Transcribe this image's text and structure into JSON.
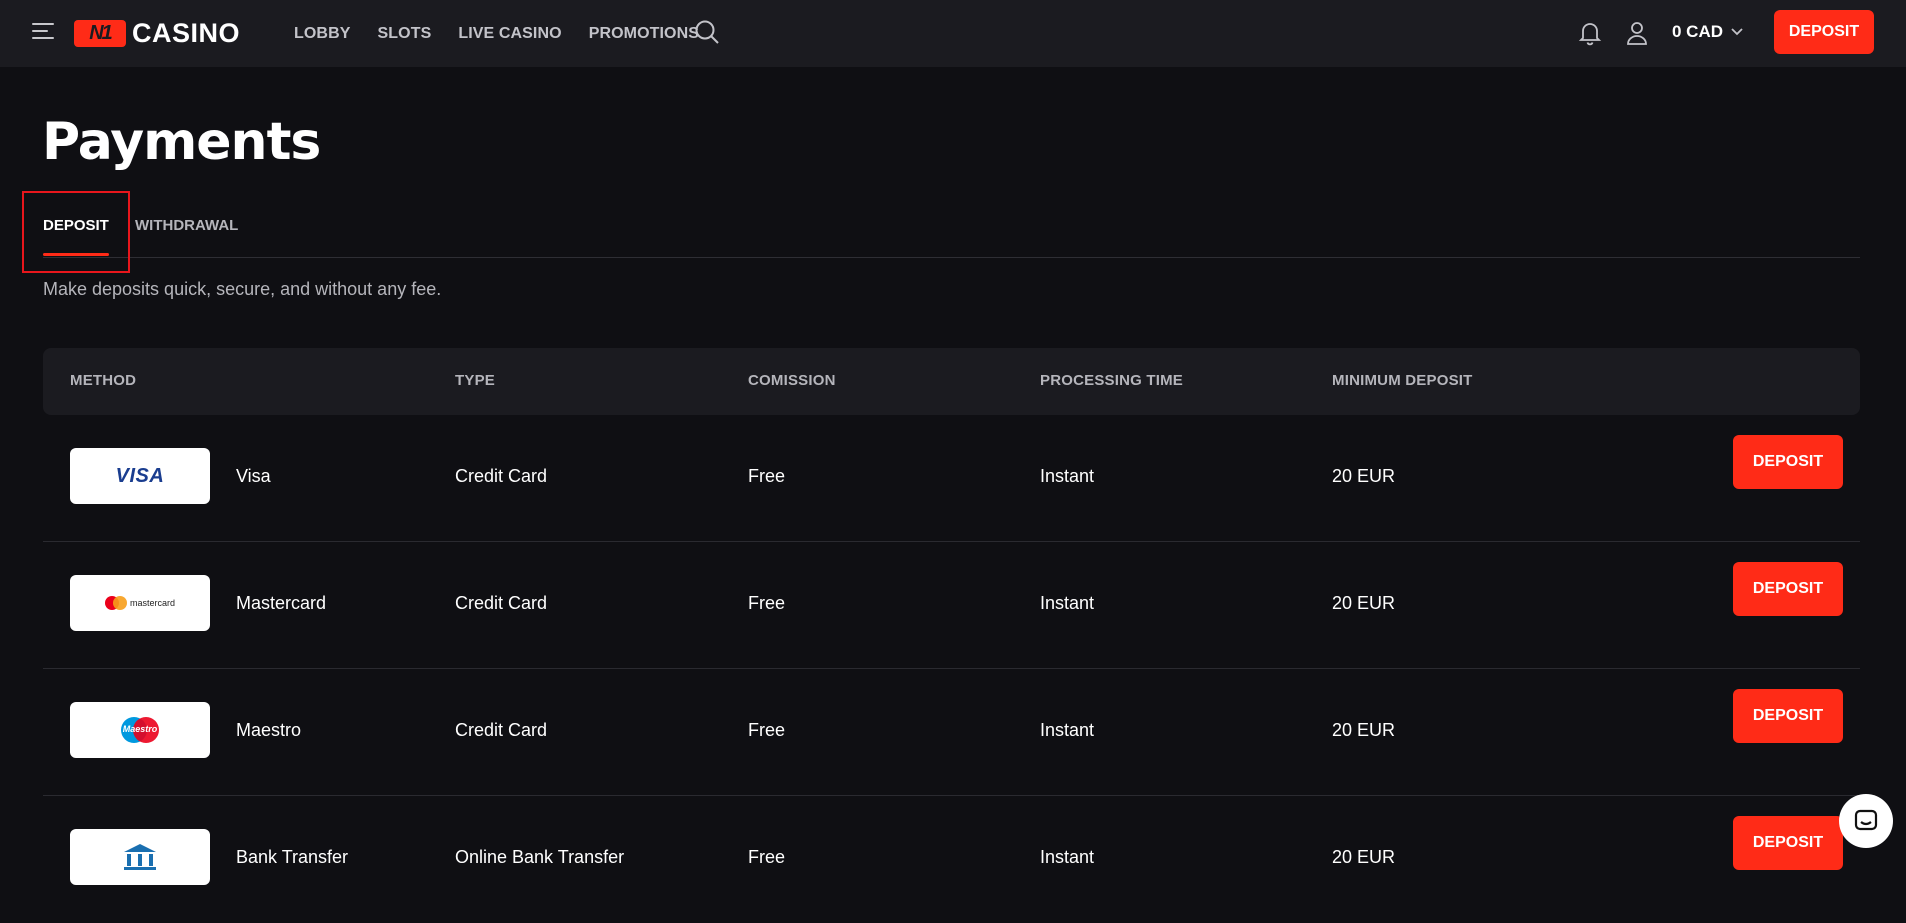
{
  "header": {
    "logo_mark": "N1",
    "logo_text": "CASINO",
    "nav": [
      "LOBBY",
      "SLOTS",
      "LIVE CASINO",
      "PROMOTIONS"
    ],
    "balance": "0 CAD",
    "deposit_label": "DEPOSIT"
  },
  "page": {
    "title": "Payments",
    "tabs": [
      {
        "label": "DEPOSIT",
        "active": true
      },
      {
        "label": "WITHDRAWAL",
        "active": false
      }
    ],
    "subtitle": "Make deposits quick, secure, and without any fee."
  },
  "table": {
    "headers": [
      "METHOD",
      "TYPE",
      "COMISSION",
      "PROCESSING TIME",
      "MINIMUM DEPOSIT"
    ],
    "rows": [
      {
        "method": "Visa",
        "logo_text": "VISA",
        "type": "Credit Card",
        "commission": "Free",
        "time": "Instant",
        "min": "20 EUR",
        "action": "DEPOSIT"
      },
      {
        "method": "Mastercard",
        "logo_text": "mastercard",
        "type": "Credit Card",
        "commission": "Free",
        "time": "Instant",
        "min": "20 EUR",
        "action": "DEPOSIT"
      },
      {
        "method": "Maestro",
        "logo_text": "Maestro",
        "type": "Credit Card",
        "commission": "Free",
        "time": "Instant",
        "min": "20 EUR",
        "action": "DEPOSIT"
      },
      {
        "method": "Bank Transfer",
        "type": "Online Bank Transfer",
        "commission": "Free",
        "time": "Instant",
        "min": "20 EUR",
        "action": "DEPOSIT"
      }
    ]
  },
  "colors": {
    "accent": "#ff2b17",
    "background": "#0f0f13",
    "header_bg": "#1b1b20",
    "muted_text": "#b5b5bb"
  }
}
